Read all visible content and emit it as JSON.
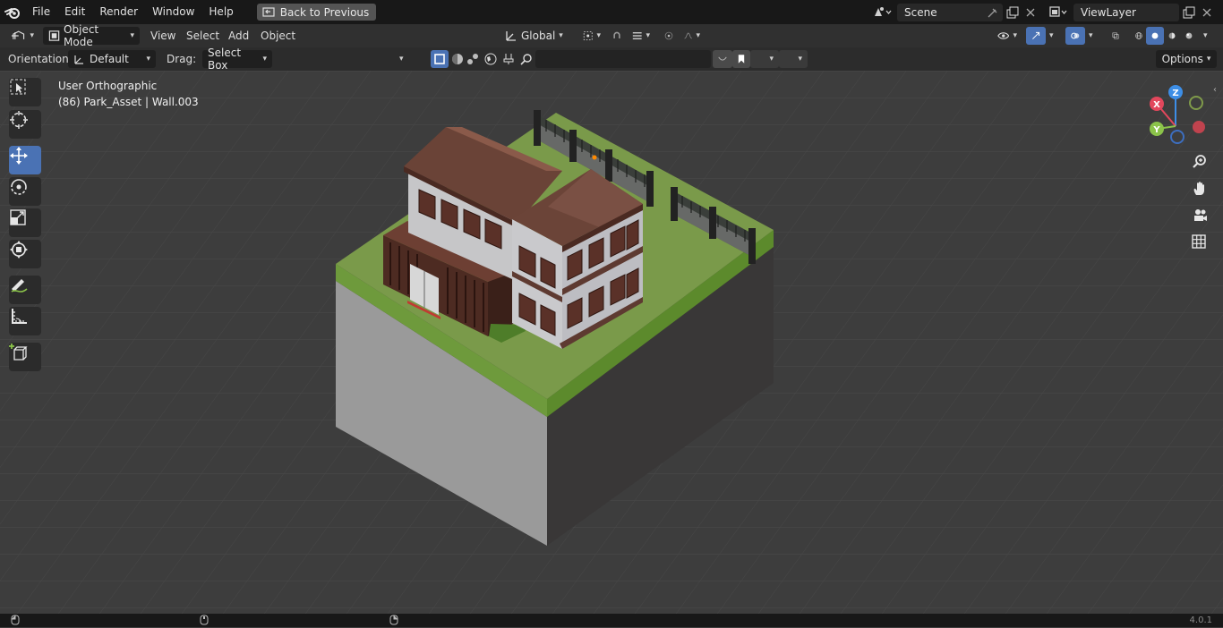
{
  "menu": {
    "items": [
      "File",
      "Edit",
      "Render",
      "Window",
      "Help"
    ],
    "back_button": "Back to Previous"
  },
  "scene": {
    "name": "Scene"
  },
  "view_layer": {
    "name": "ViewLayer"
  },
  "header": {
    "mode": "Object Mode",
    "menus": [
      "View",
      "Select",
      "Add",
      "Object"
    ],
    "transform_orientation": "Global"
  },
  "tool_settings": {
    "orientation_label": "Orientation:",
    "orientation_value": "Default",
    "drag_label": "Drag:",
    "drag_value": "Select Box",
    "options_label": "Options"
  },
  "viewport": {
    "view_name": "User Orthographic",
    "context": "(86) Park_Asset | Wall.003"
  },
  "gizmo": {
    "x": "X",
    "y": "Y",
    "z": "Z"
  },
  "colors": {
    "accent": "#4a72b4",
    "grass": "#7a9a4a",
    "roof": "#6b4438",
    "wall": "#c9c9cc",
    "axis_x": "#e2475c",
    "axis_y": "#8bc34a",
    "axis_z": "#3d8ee6"
  },
  "toolbar": {
    "tools": [
      "select-box",
      "cursor",
      "move",
      "rotate",
      "scale",
      "transform",
      "annotate",
      "measure",
      "add-cube"
    ],
    "active": "move"
  },
  "status": {
    "version": "4.0.1"
  }
}
